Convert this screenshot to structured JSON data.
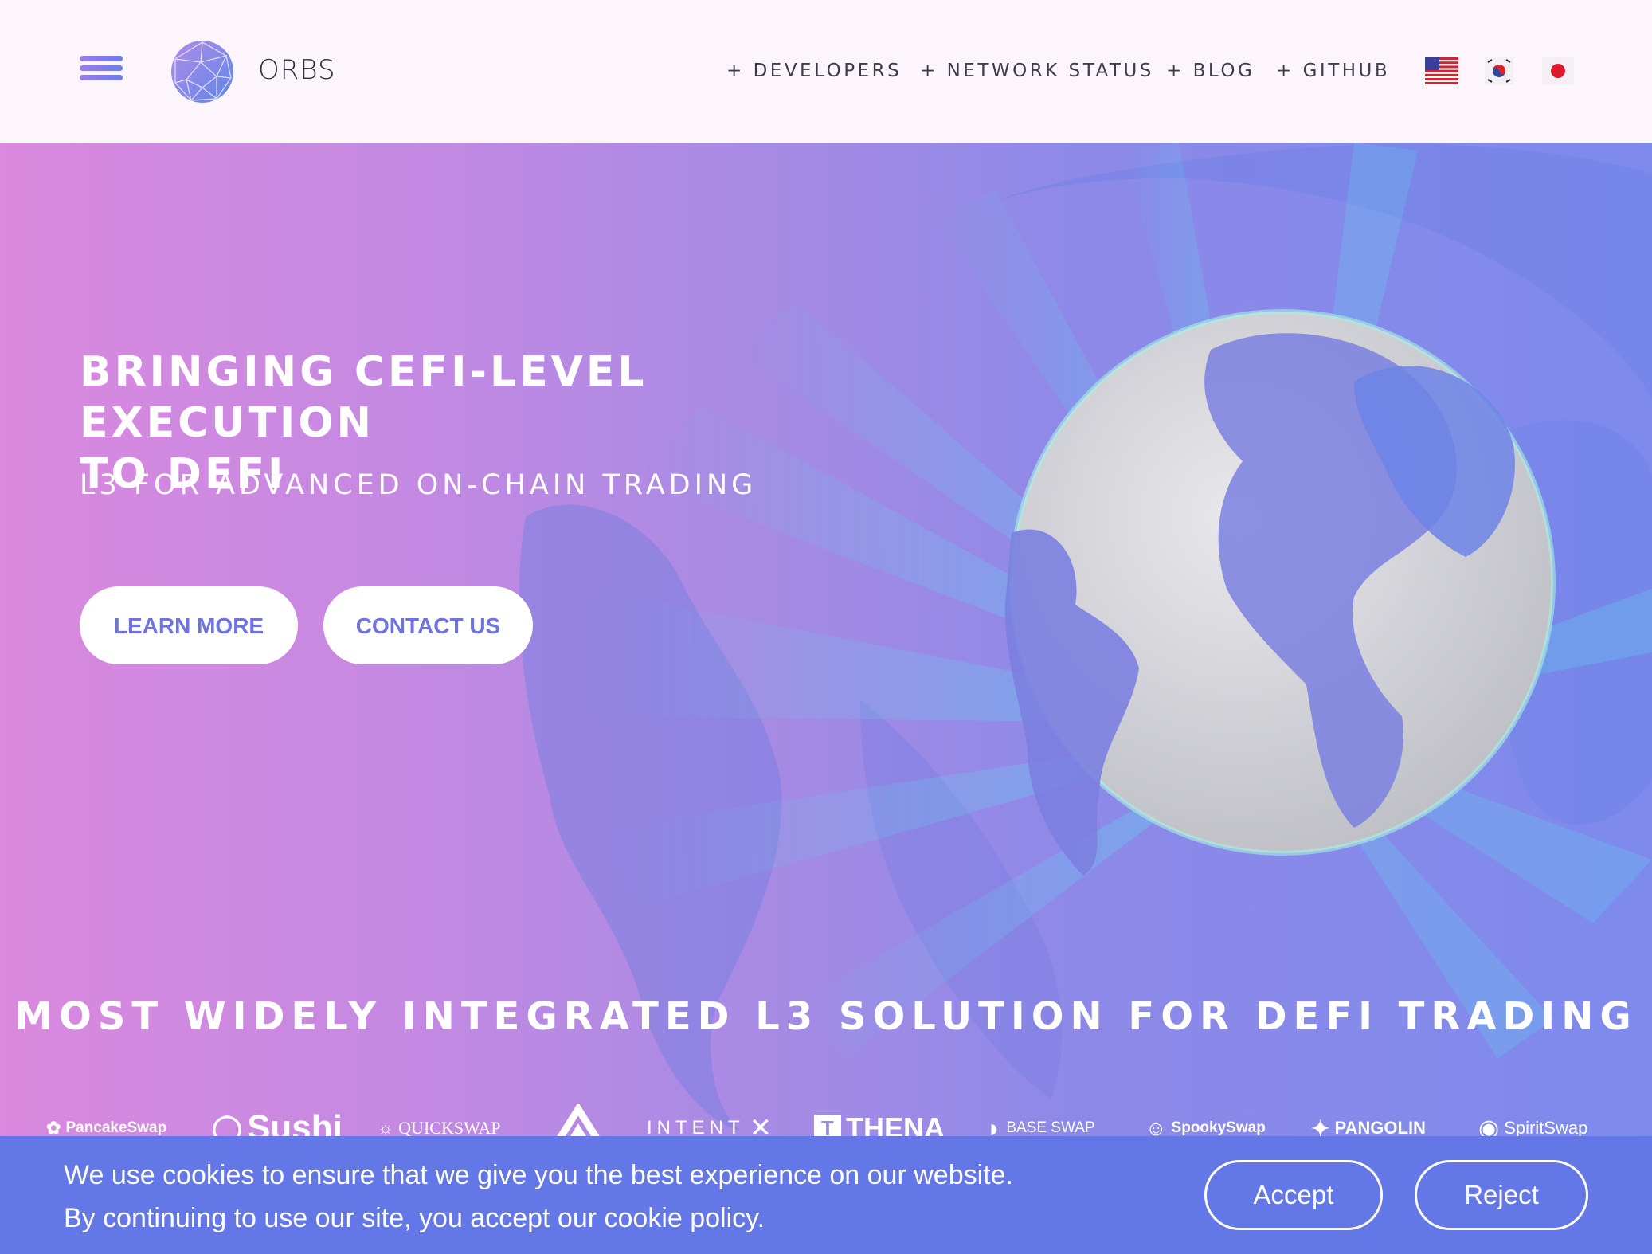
{
  "header": {
    "logo_text": "ORBS",
    "nav": [
      "+ DEVELOPERS",
      "+ NETWORK STATUS",
      "+ BLOG",
      "+ GITHUB"
    ],
    "languages": [
      "English (US flag)",
      "Korean (KR flag)",
      "Japanese (JP flag)"
    ]
  },
  "hero": {
    "headline_line1": "BRINGING CEFI-LEVEL EXECUTION",
    "headline_line2": "TO DEFI",
    "subheadline": "L3 FOR ADVANCED ON-CHAIN TRADING",
    "learn_more": "LEARN MORE",
    "contact_us": "CONTACT US"
  },
  "integrations": {
    "title": "MOST WIDELY INTEGRATED L3 SOLUTION FOR DEFI TRADING",
    "partners": [
      "PancakeSwap",
      "Sushi",
      "QUICKSWAP",
      "",
      "INTENT",
      "THENA",
      "BASE SWAP",
      "SpookySwap",
      "PANGOLIN",
      "SpiritSwap"
    ]
  },
  "cookie": {
    "line1": "We use cookies to ensure that we give you the best experience on our website.",
    "line2": "By continuing to use our site, you accept our cookie policy.",
    "accept": "Accept",
    "reject": "Reject"
  },
  "colors": {
    "accent": "#6e72e2",
    "cookie_bar": "#6477e6",
    "hero_gradient_left": "#d989de",
    "hero_gradient_right": "#7d8aec"
  }
}
